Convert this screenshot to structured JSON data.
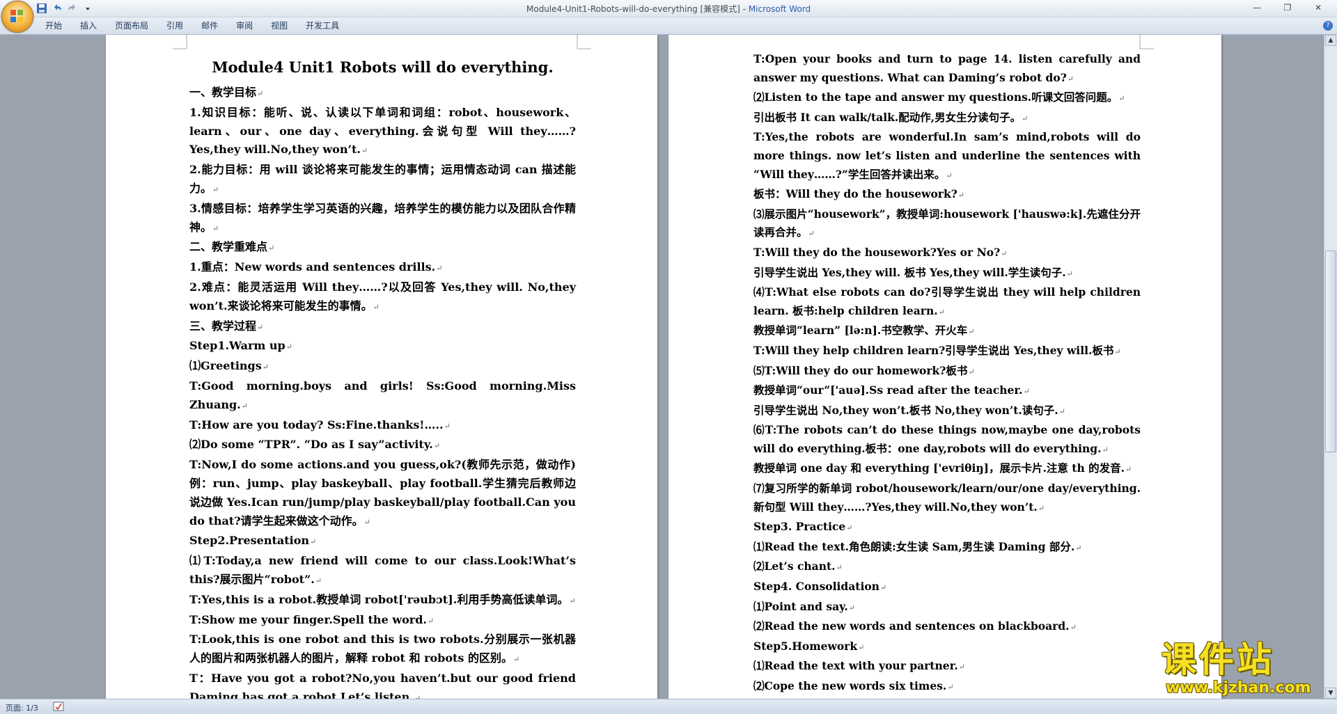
{
  "window": {
    "title_doc": "Module4-Unit1-Robots-will-do-everything [兼容模式] - ",
    "title_app": "Microsoft Word",
    "controls": [
      "—",
      "❐",
      "✕"
    ]
  },
  "ribbon": {
    "tabs": [
      "开始",
      "插入",
      "页面布局",
      "引用",
      "邮件",
      "审阅",
      "视图",
      "开发工具"
    ],
    "help": "?"
  },
  "page1": {
    "title": "Module4 Unit1 Robots will do everything.",
    "paragraphs": [
      "一、教学目标",
      "1.知识目标：能听、说、认读以下单词和词组：robot、housework、learn、our、one day、everything.会说句型 Will they……?Yes,they will.No,they won’t.",
      "2.能力目标：用 will 谈论将来可能发生的事情；运用情态动词 can 描述能力。",
      "3.情感目标：培养学生学习英语的兴趣，培养学生的模仿能力以及团队合作精神。",
      "二、教学重难点",
      "1.重点：New words and sentences drills.",
      "2.难点：能灵活运用 Will they……?以及回答 Yes,they will. No,they won’t.来谈论将来可能发生的事情。",
      "三、教学过程",
      "Step1.Warm up",
      "⑴Greetings",
      "T:Good morning.boys and girls!      Ss:Good morning.Miss Zhuang.",
      "T:How are you today?                    Ss:Fine.thanks!…..",
      "⑵Do some “TPR”. “Do as I say”activity.",
      "T:Now,I do some actions.and you guess,ok?(教师先示范，做动作)例：run、jump、play baskeyball、play football.学生猜完后教师边说边做 Yes.Ican run/jump/play baskeyball/play football.Can you do that?请学生起来做这个动作。",
      "Step2.Presentation",
      "⑴T:Today,a new friend will come to our class.Look!What’s this?展示图片“robot”.",
      "T:Yes,this is a robot.教授单词 robot['rəubɔt].利用手势高低读单词。",
      "T:Show me your finger.Spell the word.",
      "T:Look,this is one robot and this is two robots.分别展示一张机器人的图片和两张机器人的图片，解释 robot 和 robots 的区别。",
      "T：Have you got a robot?No,you haven’t.but our good friend Daming has got a robot.Let’s listen."
    ]
  },
  "page2": {
    "paragraphs": [
      "T:Open your books and turn to page 14. listen carefully and answer my questions. What can Daming’s robot do?",
      "⑵Listen to the tape and answer my questions.听课文回答问题。",
      "引出板书 It can walk/talk.配动作,男女生分读句子。",
      "T:Yes,the robots are wonderful.In sam’s mind,robots will do more things. now let’s listen and underline the sentences with “Will they……?”学生回答并读出来。",
      "板书：Will they do the housework?",
      "⑶展示图片“housework”，教授单词:housework ['hauswə:k].先遮住分开读再合并。",
      "T:Will they do the housework?Yes or No?",
      "引导学生说出 Yes,they will. 板书 Yes,they will.学生读句子.",
      "⑷T:What else robots can do?引导学生说出 they will help children learn. 板书:help children learn.",
      "教授单词“learn” [lə:n].书空教学、开火车",
      "T:Will they help children learn?引导学生说出 Yes,they will.板书",
      "⑸T:Will they do our homework?板书",
      "教授单词“our”['auə].Ss read after the teacher.",
      "引导学生说出 No,they won’t.板书 No,they won’t.读句子.",
      "⑹T:The robots can’t do these things now,maybe one day,robots will do everything.板书：one day,robots will do everything.",
      "教授单词 one day 和 everything ['evriθiŋ]，展示卡片.注意 th 的发音.",
      "⑺复习所学的新单词 robot/housework/learn/our/one day/everything.新句型 Will they……?Yes,they will.No,they won’t.",
      "Step3. Practice",
      "⑴Read the text.角色朗读:女生读 Sam,男生读 Daming 部分.",
      "⑵Let’s chant.",
      "Step4. Consolidation",
      "⑴Point and say.",
      "⑵Read the new words and sentences on blackboard.",
      "Step5.Homework",
      "⑴Read the text with your partner.",
      "⑵Cope the new words six times."
    ]
  },
  "paragraph_mark": "↵",
  "statusbar": {
    "page_indicator": "页面: 1/3"
  },
  "watermark": {
    "text_cn": "课件站",
    "url": "www.kjzhan.com"
  },
  "scrollbar": {
    "up": "▲",
    "down": "▼"
  }
}
